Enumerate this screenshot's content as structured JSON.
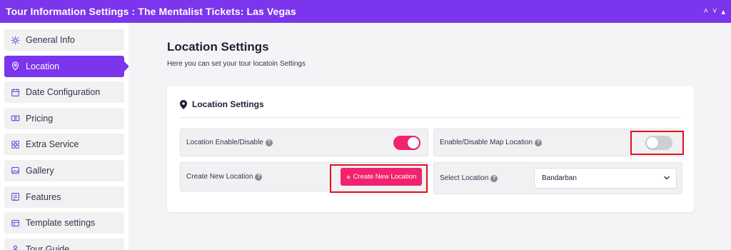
{
  "header": {
    "title": "Tour Information Settings : The Mentalist Tickets: Las Vegas",
    "controls": [
      "˄",
      "˅",
      "▴"
    ]
  },
  "sidebar": {
    "items": [
      {
        "label": "General Info",
        "icon": "gear-icon"
      },
      {
        "label": "Location",
        "icon": "location-pin-icon"
      },
      {
        "label": "Date Configuration",
        "icon": "calendar-icon"
      },
      {
        "label": "Pricing",
        "icon": "money-icon"
      },
      {
        "label": "Extra Service",
        "icon": "grid-icon"
      },
      {
        "label": "Gallery",
        "icon": "gallery-icon"
      },
      {
        "label": "Features",
        "icon": "features-icon"
      },
      {
        "label": "Template settings",
        "icon": "template-icon"
      },
      {
        "label": "Tour Guide",
        "icon": "guide-icon"
      }
    ],
    "active_index": 1
  },
  "main": {
    "title": "Location Settings",
    "subtitle": "Here you can set your tour locatoin Settings",
    "card": {
      "title": "Location Settings",
      "location_toggle_label": "Location Enable/Disable",
      "location_toggle_on": true,
      "map_toggle_label": "Enable/Disable Map Location",
      "map_toggle_on": false,
      "create_label": "Create New Location",
      "create_button_label": "Create New Location",
      "select_label": "Select Location",
      "select_value": "Bandarban"
    }
  },
  "colors": {
    "accent": "#7b35ec",
    "toggle_on": "#f1226e",
    "highlight": "#e4121f"
  }
}
